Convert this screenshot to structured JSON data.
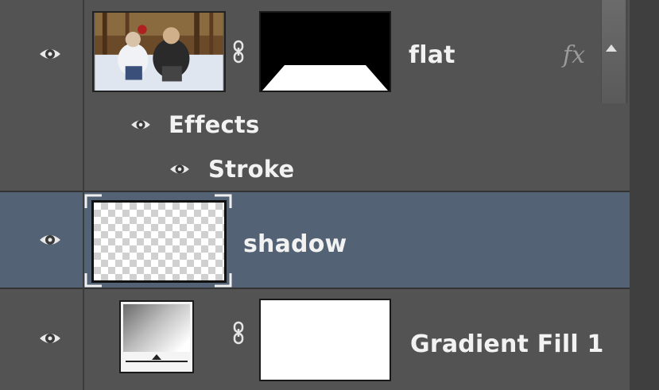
{
  "layers": [
    {
      "name": "flat",
      "has_fx": true,
      "fx_label": "fx",
      "selected": false,
      "visible": true,
      "effects": {
        "label": "Effects",
        "items": [
          {
            "label": "Stroke"
          }
        ]
      }
    },
    {
      "name": "shadow",
      "selected": true,
      "visible": true
    },
    {
      "name": "Gradient Fill 1",
      "selected": false,
      "visible": true
    }
  ],
  "icons": {
    "visibility": "eye-icon",
    "link": "chain-link-icon",
    "fx": "fx-icon",
    "scroll_up": "triangle-up-icon"
  },
  "colors": {
    "panel_bg": "#535353",
    "selected_row": "#536275",
    "text": "#f2f2f2"
  }
}
